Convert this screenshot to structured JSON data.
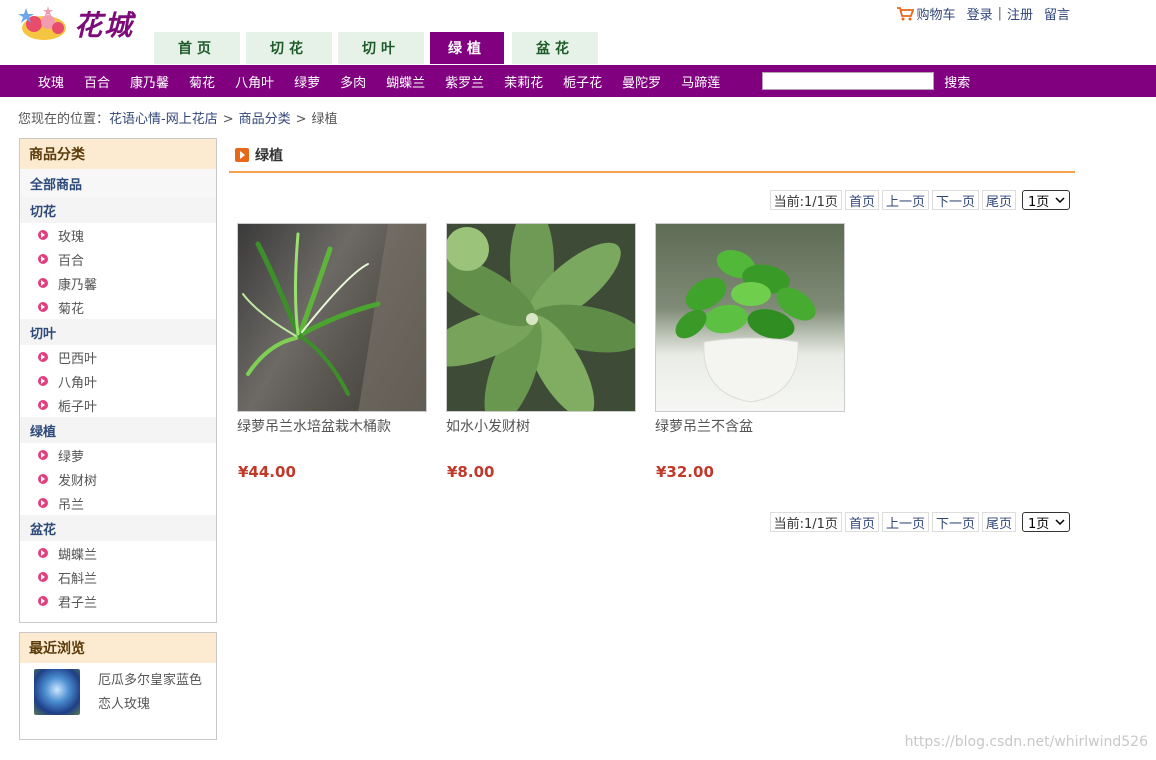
{
  "header": {
    "logo_text": "花城",
    "cart_label": "购物车",
    "login_label": "登录",
    "sep": "|",
    "register_label": "注册",
    "message_label": "留言"
  },
  "tabs": [
    {
      "label": "首页",
      "active": false
    },
    {
      "label": "切花",
      "active": false
    },
    {
      "label": "切叶",
      "active": false
    },
    {
      "label": "绿植",
      "active": true
    },
    {
      "label": "盆花",
      "active": false
    }
  ],
  "category_bar": {
    "items": [
      "玫瑰",
      "百合",
      "康乃馨",
      "菊花",
      "八角叶",
      "绿萝",
      "多肉",
      "蝴蝶兰",
      "紫罗兰",
      "茉莉花",
      "栀子花",
      "曼陀罗",
      "马蹄莲"
    ],
    "search_value": "",
    "search_button": "搜索"
  },
  "breadcrumb": {
    "prefix": "您现在的位置：",
    "items": [
      "花语心情-网上花店",
      "商品分类",
      "绿植"
    ],
    "sep": ">"
  },
  "sidebar": {
    "title": "商品分类",
    "all_label": "全部商品",
    "groups": [
      {
        "name": "切花",
        "items": [
          "玫瑰",
          "百合",
          "康乃馨",
          "菊花"
        ]
      },
      {
        "name": "切叶",
        "items": [
          "巴西叶",
          "八角叶",
          "栀子叶"
        ]
      },
      {
        "name": "绿植",
        "items": [
          "绿萝",
          "发财树",
          "吊兰"
        ]
      },
      {
        "name": "盆花",
        "items": [
          "蝴蝶兰",
          "石斛兰",
          "君子兰"
        ]
      }
    ]
  },
  "recent": {
    "title": "最近浏览",
    "items": [
      {
        "name": "厄瓜多尔皇家蓝色恋人玫瑰"
      }
    ]
  },
  "main": {
    "title": "绿植",
    "pager": {
      "current": "当前:1/1页",
      "first": "首页",
      "prev": "上一页",
      "next": "下一页",
      "last": "尾页",
      "select_value": "1页"
    },
    "products": [
      {
        "name": "绿萝吊兰水培盆栽木桶款",
        "price": "¥44.00"
      },
      {
        "name": "如水小发财树",
        "price": "¥8.00"
      },
      {
        "name": "绿萝吊兰不含盆",
        "price": "¥32.00"
      }
    ]
  },
  "watermark": "https://blog.csdn.net/whirlwind526",
  "colors": {
    "brand_purple": "#800080",
    "tab_bg": "#e6f2e8",
    "accent_orange": "#f6a04d",
    "price_red": "#c0392b"
  }
}
